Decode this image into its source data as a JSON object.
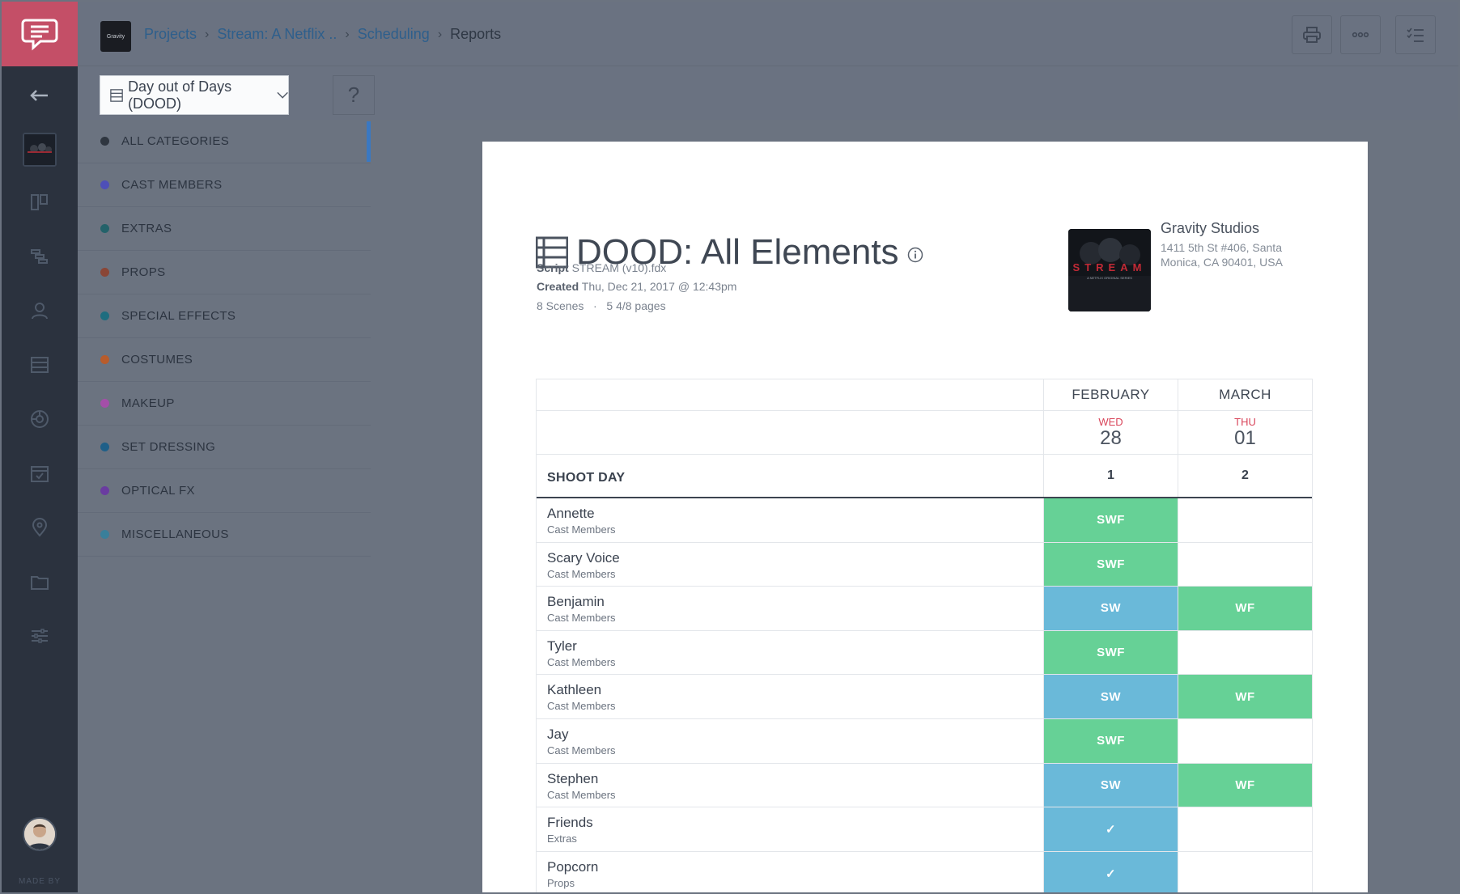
{
  "rail": {
    "made_by": "MADE BY",
    "icons": [
      "back-arrow-icon",
      "board-icon",
      "schedule-icon",
      "cast-icon",
      "stripboard-icon",
      "shot-icon",
      "calendar-icon",
      "location-icon",
      "folder-icon",
      "settings-sliders-icon"
    ]
  },
  "header": {
    "brand_text": "Gravity",
    "breadcrumbs": [
      "Projects",
      "Stream: A Netflix ..",
      "Scheduling"
    ],
    "current": "Reports"
  },
  "toolbar": {
    "report_select": "Day out of Days (DOOD)",
    "help": "?"
  },
  "categories": [
    {
      "label": "ALL CATEGORIES",
      "color": "#2f3640",
      "active": true
    },
    {
      "label": "CAST MEMBERS",
      "color": "#4e4fb8"
    },
    {
      "label": "EXTRAS",
      "color": "#24626a"
    },
    {
      "label": "PROPS",
      "color": "#8a4636"
    },
    {
      "label": "SPECIAL EFFECTS",
      "color": "#1f6d7f"
    },
    {
      "label": "COSTUMES",
      "color": "#b85c2c"
    },
    {
      "label": "MAKEUP",
      "color": "#a44fa8"
    },
    {
      "label": "SET DRESSING",
      "color": "#1f5f88"
    },
    {
      "label": "OPTICAL FX",
      "color": "#6a3ca0"
    },
    {
      "label": "MISCELLANEOUS",
      "color": "#3a7f9a"
    }
  ],
  "report": {
    "title": "DOOD: All Elements",
    "script_label": "Script",
    "script_value": "STREAM (v10).fdx",
    "created_label": "Created",
    "created_value": "Thu, Dec 21, 2017 @ 12:43pm",
    "scenes": "8 Scenes",
    "dot": "·",
    "pages": "5 4/8 pages",
    "poster_text": "STREAM",
    "poster_sub": "A NETFLIX ORIGINAL SERIES",
    "studio_name": "Gravity Studios",
    "studio_addr1": "1411 5th St #406, Santa",
    "studio_addr2": "Monica, CA 90401, USA"
  },
  "table": {
    "months": [
      "FEBRUARY",
      "MARCH"
    ],
    "days": [
      {
        "dow": "WED",
        "num": "28",
        "shoot": "1"
      },
      {
        "dow": "THU",
        "num": "01",
        "shoot": "2"
      }
    ],
    "shoot_day_label": "SHOOT DAY",
    "colors": {
      "green": "#66d196",
      "blue": "#6ab9d9"
    },
    "rows": [
      {
        "name": "Annette",
        "category": "Cast Members",
        "cells": [
          {
            "text": "SWF",
            "color": "green"
          },
          {
            "text": "",
            "color": ""
          }
        ]
      },
      {
        "name": "Scary Voice",
        "category": "Cast Members",
        "cells": [
          {
            "text": "SWF",
            "color": "green"
          },
          {
            "text": "",
            "color": ""
          }
        ]
      },
      {
        "name": "Benjamin",
        "category": "Cast Members",
        "cells": [
          {
            "text": "SW",
            "color": "blue"
          },
          {
            "text": "WF",
            "color": "green"
          }
        ]
      },
      {
        "name": "Tyler",
        "category": "Cast Members",
        "cells": [
          {
            "text": "SWF",
            "color": "green"
          },
          {
            "text": "",
            "color": ""
          }
        ]
      },
      {
        "name": "Kathleen",
        "category": "Cast Members",
        "cells": [
          {
            "text": "SW",
            "color": "blue"
          },
          {
            "text": "WF",
            "color": "green"
          }
        ]
      },
      {
        "name": "Jay",
        "category": "Cast Members",
        "cells": [
          {
            "text": "SWF",
            "color": "green"
          },
          {
            "text": "",
            "color": ""
          }
        ]
      },
      {
        "name": "Stephen",
        "category": "Cast Members",
        "cells": [
          {
            "text": "SW",
            "color": "blue"
          },
          {
            "text": "WF",
            "color": "green"
          }
        ]
      },
      {
        "name": "Friends",
        "category": "Extras",
        "cells": [
          {
            "text": "✓",
            "color": "blue"
          },
          {
            "text": "",
            "color": ""
          }
        ]
      },
      {
        "name": "Popcorn",
        "category": "Props",
        "cells": [
          {
            "text": "✓",
            "color": "blue"
          },
          {
            "text": "",
            "color": ""
          }
        ]
      }
    ]
  }
}
